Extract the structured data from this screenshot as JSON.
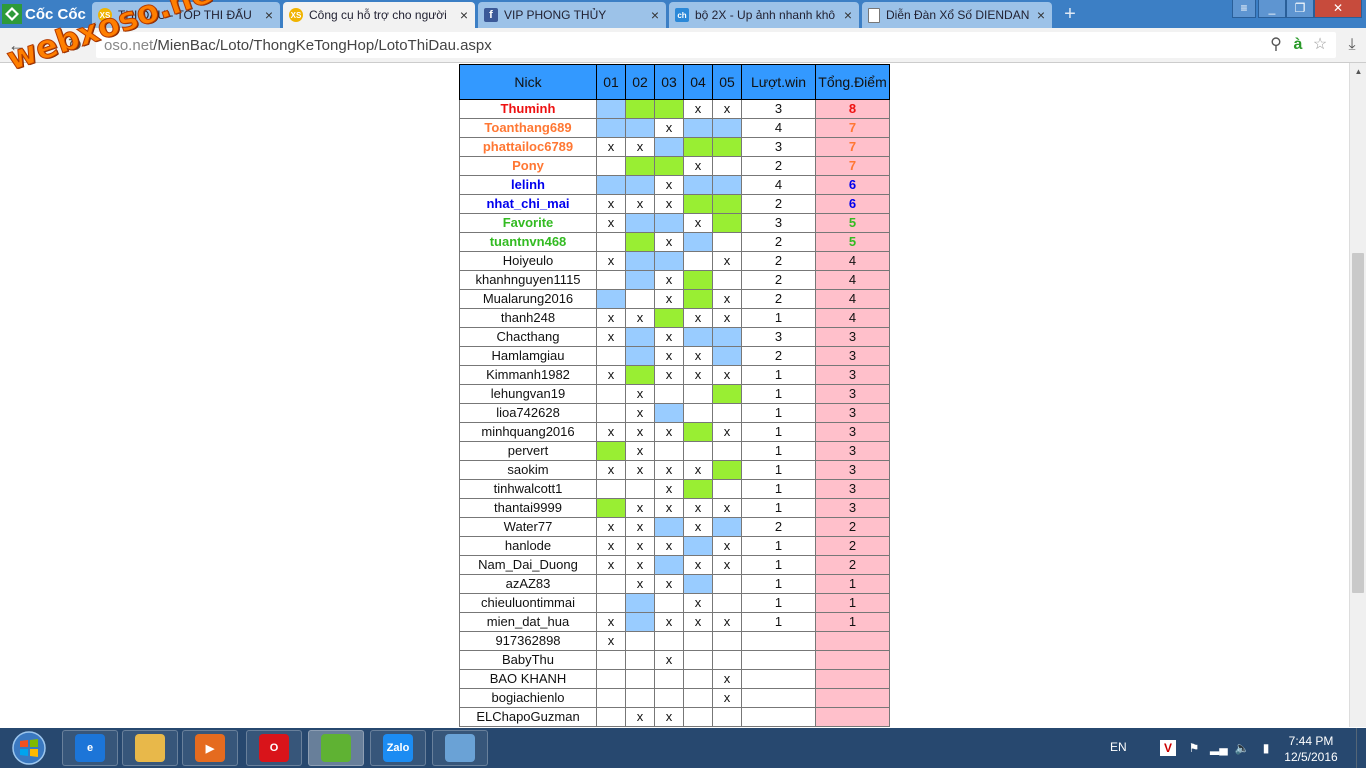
{
  "browser": {
    "brand": "Cốc Cốc",
    "tabs": [
      {
        "title": "THI ĐẤU - TOP THI ĐẤU",
        "favicon": "XS",
        "color": "#f0b400"
      },
      {
        "title": "Công cụ hỗ trợ cho người",
        "favicon": "XS",
        "color": "#f0b400"
      },
      {
        "title": "VIP PHONG THỦY",
        "favicon": "f",
        "color": "#3b5998"
      },
      {
        "title": "bộ 2X - Up ảnh nhanh khô",
        "favicon": "ch",
        "color": "#2a88d8"
      },
      {
        "title": "Diễn Đàn Xổ Số DIENDAN",
        "favicon": "page-icon",
        "color": "#ffffff"
      }
    ],
    "address_host": "oso.net",
    "address_path": "/MienBac/Loto/ThongKeTongHop/LotoThiDau.aspx"
  },
  "watermark": "webxoso.net",
  "table": {
    "headers": [
      "Nick",
      "01",
      "02",
      "03",
      "04",
      "05",
      "Lượt.win",
      "Tổng.Điểm"
    ],
    "colors": {
      "blue": "#99ccff",
      "green": "#99ee33",
      "score_bg": "#ffc0cb",
      "header_bg": "#3399ff"
    },
    "rows": [
      {
        "nick": "Thuminh",
        "cells": [
          "b",
          "g",
          "g",
          "x",
          "x"
        ],
        "wins": "3",
        "score": "8",
        "color": "#ee1111",
        "bold": true
      },
      {
        "nick": "Toanthang689",
        "cells": [
          "b",
          "b",
          "x",
          "b",
          "b"
        ],
        "wins": "4",
        "score": "7",
        "color": "#ff7733",
        "bold": true
      },
      {
        "nick": "phattailoc6789",
        "cells": [
          "x",
          "x",
          "b",
          "g",
          "g"
        ],
        "wins": "3",
        "score": "7",
        "color": "#ff7733",
        "bold": true
      },
      {
        "nick": "Pony",
        "cells": [
          "",
          "g",
          "g",
          "x",
          ""
        ],
        "wins": "2",
        "score": "7",
        "color": "#ff7733",
        "bold": true
      },
      {
        "nick": "lelinh",
        "cells": [
          "b",
          "b",
          "x",
          "b",
          "b"
        ],
        "wins": "4",
        "score": "6",
        "color": "#0000ee",
        "bold": true
      },
      {
        "nick": "nhat_chi_mai",
        "cells": [
          "x",
          "x",
          "x",
          "g",
          "g"
        ],
        "wins": "2",
        "score": "6",
        "color": "#0000ee",
        "bold": true
      },
      {
        "nick": "Favorite",
        "cells": [
          "x",
          "b",
          "b",
          "x",
          "g"
        ],
        "wins": "3",
        "score": "5",
        "color": "#33bb22",
        "bold": true
      },
      {
        "nick": "tuantnvn468",
        "cells": [
          "",
          "g",
          "x",
          "b",
          ""
        ],
        "wins": "2",
        "score": "5",
        "color": "#33bb22",
        "bold": true
      },
      {
        "nick": "Hoiyeulo",
        "cells": [
          "x",
          "b",
          "b",
          "",
          "x"
        ],
        "wins": "2",
        "score": "4",
        "color": "#111111",
        "bold": false
      },
      {
        "nick": "khanhnguyen1115",
        "cells": [
          "",
          "b",
          "x",
          "g",
          ""
        ],
        "wins": "2",
        "score": "4",
        "color": "#111111",
        "bold": false
      },
      {
        "nick": "Mualarung2016",
        "cells": [
          "b",
          "",
          "x",
          "g",
          "x"
        ],
        "wins": "2",
        "score": "4",
        "color": "#111111",
        "bold": false
      },
      {
        "nick": "thanh248",
        "cells": [
          "x",
          "x",
          "g",
          "x",
          "x"
        ],
        "wins": "1",
        "score": "4",
        "color": "#111111",
        "bold": false
      },
      {
        "nick": "Chacthang",
        "cells": [
          "x",
          "b",
          "x",
          "b",
          "b"
        ],
        "wins": "3",
        "score": "3",
        "color": "#111111",
        "bold": false
      },
      {
        "nick": "Hamlamgiau",
        "cells": [
          "",
          "b",
          "x",
          "x",
          "b"
        ],
        "wins": "2",
        "score": "3",
        "color": "#111111",
        "bold": false
      },
      {
        "nick": "Kimmanh1982",
        "cells": [
          "x",
          "g",
          "x",
          "x",
          "x"
        ],
        "wins": "1",
        "score": "3",
        "color": "#111111",
        "bold": false
      },
      {
        "nick": "lehungvan19",
        "cells": [
          "",
          "x",
          "",
          "",
          "g"
        ],
        "wins": "1",
        "score": "3",
        "color": "#111111",
        "bold": false
      },
      {
        "nick": "lioa742628",
        "cells": [
          "",
          "x",
          "b",
          "",
          ""
        ],
        "wins": "1",
        "score": "3",
        "color": "#111111",
        "bold": false
      },
      {
        "nick": "minhquang2016",
        "cells": [
          "x",
          "x",
          "x",
          "g",
          "x"
        ],
        "wins": "1",
        "score": "3",
        "color": "#111111",
        "bold": false
      },
      {
        "nick": "pervert",
        "cells": [
          "g",
          "x",
          "",
          "",
          ""
        ],
        "wins": "1",
        "score": "3",
        "color": "#111111",
        "bold": false
      },
      {
        "nick": "saokim",
        "cells": [
          "x",
          "x",
          "x",
          "x",
          "g"
        ],
        "wins": "1",
        "score": "3",
        "color": "#111111",
        "bold": false
      },
      {
        "nick": "tinhwalcott1",
        "cells": [
          "",
          "",
          "x",
          "g",
          ""
        ],
        "wins": "1",
        "score": "3",
        "color": "#111111",
        "bold": false
      },
      {
        "nick": "thantai9999",
        "cells": [
          "g",
          "x",
          "x",
          "x",
          "x"
        ],
        "wins": "1",
        "score": "3",
        "color": "#111111",
        "bold": false
      },
      {
        "nick": "Water77",
        "cells": [
          "x",
          "x",
          "b",
          "x",
          "b"
        ],
        "wins": "2",
        "score": "2",
        "color": "#111111",
        "bold": false
      },
      {
        "nick": "hanlode",
        "cells": [
          "x",
          "x",
          "x",
          "b",
          "x"
        ],
        "wins": "1",
        "score": "2",
        "color": "#111111",
        "bold": false
      },
      {
        "nick": "Nam_Dai_Duong",
        "cells": [
          "x",
          "x",
          "b",
          "x",
          "x"
        ],
        "wins": "1",
        "score": "2",
        "color": "#111111",
        "bold": false
      },
      {
        "nick": "azAZ83",
        "cells": [
          "",
          "x",
          "x",
          "b",
          ""
        ],
        "wins": "1",
        "score": "1",
        "color": "#111111",
        "bold": false
      },
      {
        "nick": "chieuluontimmai",
        "cells": [
          "",
          "b",
          "",
          "x",
          ""
        ],
        "wins": "1",
        "score": "1",
        "color": "#111111",
        "bold": false
      },
      {
        "nick": "mien_dat_hua",
        "cells": [
          "x",
          "b",
          "x",
          "x",
          "x"
        ],
        "wins": "1",
        "score": "1",
        "color": "#111111",
        "bold": false
      },
      {
        "nick": "917362898",
        "cells": [
          "x",
          "",
          "",
          "",
          ""
        ],
        "wins": "",
        "score": "",
        "color": "#111111",
        "bold": false
      },
      {
        "nick": "BabyThu",
        "cells": [
          "",
          "",
          "x",
          "",
          ""
        ],
        "wins": "",
        "score": "",
        "color": "#111111",
        "bold": false
      },
      {
        "nick": "BAO KHANH",
        "cells": [
          "",
          "",
          "",
          "",
          "x"
        ],
        "wins": "",
        "score": "",
        "color": "#111111",
        "bold": false
      },
      {
        "nick": "bogiachienlo",
        "cells": [
          "",
          "",
          "",
          "",
          "x"
        ],
        "wins": "",
        "score": "",
        "color": "#111111",
        "bold": false
      },
      {
        "nick": "ELChapoGuzman",
        "cells": [
          "",
          "x",
          "x",
          "",
          ""
        ],
        "wins": "",
        "score": "",
        "color": "#111111",
        "bold": false
      }
    ]
  },
  "taskbar": {
    "apps": [
      {
        "name": "internet-explorer",
        "label": "e",
        "color": "#1c75d8"
      },
      {
        "name": "file-explorer",
        "label": "",
        "color": "#e8b84a"
      },
      {
        "name": "media-player",
        "label": "▶",
        "color": "#e56b1f"
      },
      {
        "name": "opera",
        "label": "O",
        "color": "#d9141a"
      },
      {
        "name": "coccoc",
        "label": "",
        "color": "#5fb233"
      },
      {
        "name": "zalo",
        "label": "Zalo",
        "color": "#1c8cf2"
      },
      {
        "name": "image-viewer",
        "label": "",
        "color": "#6aa2d6"
      }
    ],
    "language": "EN",
    "time": "7:44 PM",
    "date": "12/5/2016"
  }
}
